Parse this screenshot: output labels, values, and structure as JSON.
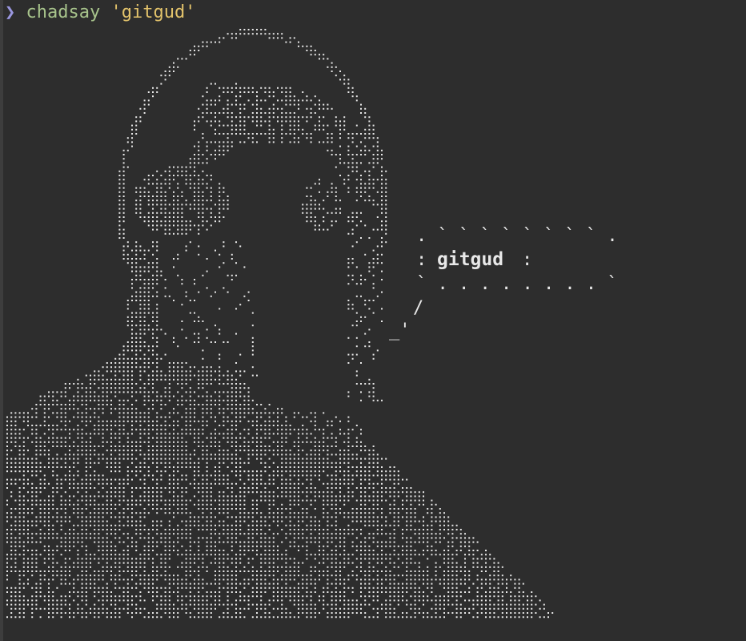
{
  "terminal": {
    "prompt_symbol": "❯",
    "command": "chadsay",
    "argument": "'gitgud'"
  },
  "speech_bubble": {
    "top": ". ` ` ` ` ` ` ` ` .",
    "middle_left": ":",
    "text": "gitgud",
    "middle_right": ":",
    "bottom": "` . . . . . . . . `",
    "tail_upper": "/",
    "tail_lower": "_'"
  },
  "colors": {
    "background": "#2d2d2d",
    "prompt_symbol": "#9a97e0",
    "command": "#a8c48c",
    "argument": "#e3c36b",
    "art": "#e8e8e8"
  }
}
